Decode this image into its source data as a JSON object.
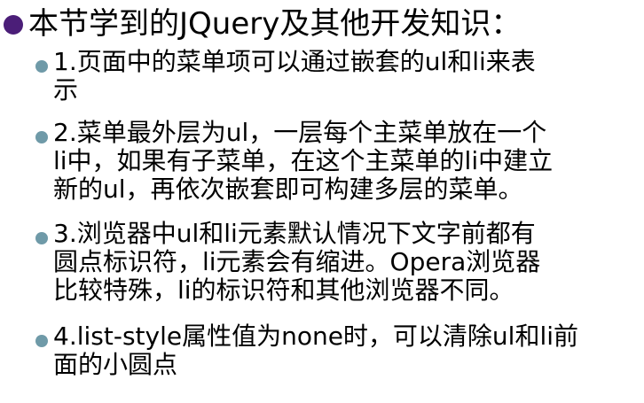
{
  "colors": {
    "title_bullet": "#4b1e78",
    "item_bullet": "#6f9aa8",
    "text": "#000000",
    "background": "#ffffff"
  },
  "title": {
    "icon": "purple-circle-bullet-icon",
    "text": "本节学到的JQuery及其他开发知识："
  },
  "items": [
    {
      "icon": "teal-circle-bullet-icon",
      "lines": [
        "1.页面中的菜单项可以通过嵌套的ul和li来表",
        "示"
      ]
    },
    {
      "icon": "teal-circle-bullet-icon",
      "lines": [
        "2.菜单最外层为ul，一层每个主菜单放在一个",
        "li中，如果有子菜单，在这个主菜单的li中建立",
        "新的ul，再依次嵌套即可构建多层的菜单。"
      ]
    },
    {
      "icon": "teal-circle-bullet-icon",
      "lines": [
        "3.浏览器中ul和li元素默认情况下文字前都有",
        "圆点标识符，li元素会有缩进。Opera浏览器",
        "比较特殊，li的标识符和其他浏览器不同。"
      ]
    },
    {
      "icon": "teal-circle-bullet-icon",
      "lines": [
        "4.list-style属性值为none时，可以清除ul和li前",
        "面的小圆点"
      ]
    }
  ]
}
